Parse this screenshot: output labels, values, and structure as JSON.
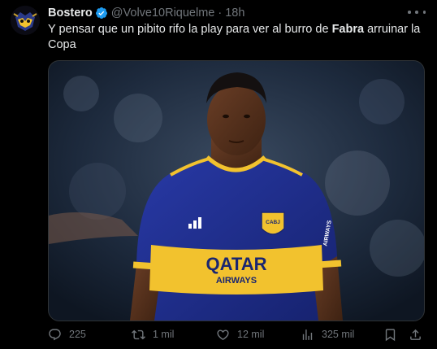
{
  "tweet": {
    "author_name": "Bostero",
    "handle": "@Volve10Riquelme",
    "separator": "·",
    "time": "18h",
    "text_part1": "Y pensar que un pibito rifo la play para ver al burro de ",
    "text_bold": "Fabra",
    "text_part2": " arruinar la Copa",
    "media": {
      "jersey_sponsor_line1": "QATAR",
      "jersey_sponsor_line2": "AIRWAYS",
      "crest_text": "CABJ",
      "sleeve_text": "AIRWAYS"
    }
  },
  "actions": {
    "replies": "225",
    "retweets": "1 mil",
    "likes": "12 mil",
    "views": "325 mil"
  },
  "colors": {
    "background": "#000000",
    "text": "#e7e9ea",
    "muted": "#71767b",
    "verified": "#1d9bf0",
    "boca_blue": "#1f2f8c",
    "boca_gold": "#f2c22e"
  },
  "icons": [
    "verified-badge-icon",
    "more-icon",
    "reply-icon",
    "retweet-icon",
    "like-icon",
    "views-icon",
    "bookmark-icon",
    "share-icon",
    "adidas-logo-icon"
  ]
}
